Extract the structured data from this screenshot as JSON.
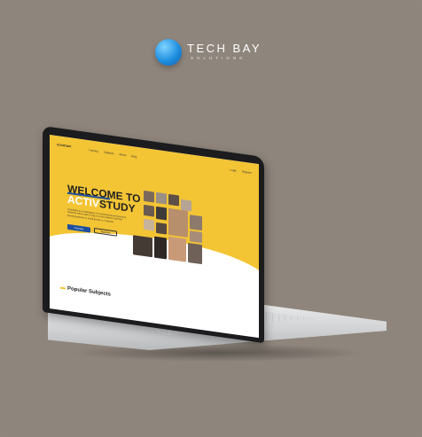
{
  "brand": {
    "name": "TECH BAY",
    "sub": "SOLUTIONS"
  },
  "site": {
    "logo_a": "ACTIV",
    "logo_b": "STUDY",
    "nav_links": [
      "Tutoring",
      "Subjects",
      "About",
      "Blog"
    ],
    "nav_right": [
      "Login",
      "Register"
    ],
    "title_line1": "WELCOME TO",
    "title_line2a": "ACTIV",
    "title_line2b": "STUDY",
    "description": "ActivStudy is a marketplace for professional and teachers. Students will be able to log on to the platform and find tutoring sessions in small groups or in private.",
    "cta_primary": "Courses",
    "cta_secondary": "Teachers",
    "section_title": "Popular Subjects"
  },
  "colors": {
    "background": "#8e857c",
    "hero_yellow": "#f3c434",
    "accent_blue": "#1d4f9e"
  }
}
